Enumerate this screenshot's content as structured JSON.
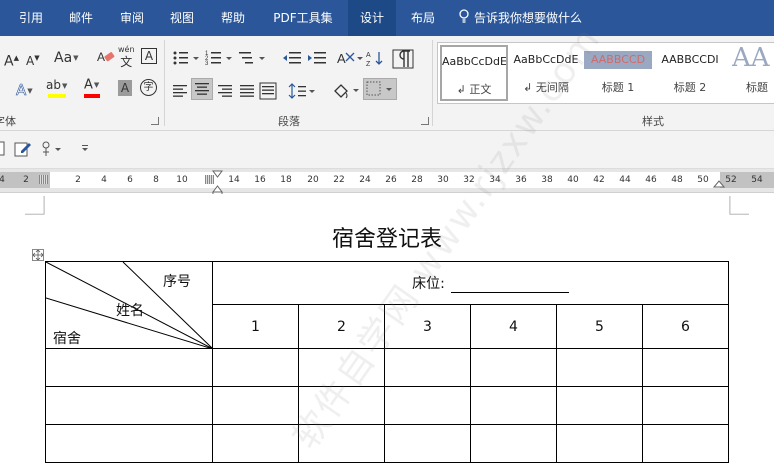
{
  "menu": {
    "tabs": [
      "引用",
      "邮件",
      "审阅",
      "视图",
      "帮助",
      "PDF工具集",
      "设计",
      "布局"
    ],
    "active_tab": "设计",
    "tell_me": "告诉我你想要做什么"
  },
  "ribbon": {
    "groups": {
      "font": "字体",
      "paragraph": "段落",
      "styles": "样式"
    },
    "font_controls": {
      "grow": "A",
      "shrink": "A",
      "change_case": "Aa",
      "pinyin": "wén",
      "char_border": "A",
      "text_effects": "A",
      "highlight": "ab",
      "font_color": "A",
      "char_shading": "A",
      "enclose": "字"
    },
    "styles": [
      {
        "sample": "AaBbCcDdE",
        "name": "正文",
        "marker": "↲"
      },
      {
        "sample": "AaBbCcDdE",
        "name": "无间隔",
        "marker": "↲"
      },
      {
        "sample": "AABBCCD",
        "name": "标题 1",
        "marker": ""
      },
      {
        "sample": "AABBCCDI",
        "name": "标题 2",
        "marker": ""
      },
      {
        "sample": "AA",
        "name": "标题",
        "marker": ""
      }
    ]
  },
  "ruler": {
    "left_ticks": [
      "4",
      "2"
    ],
    "ticks": [
      "2",
      "4",
      "6",
      "8",
      "10",
      "14",
      "16",
      "18",
      "20",
      "22",
      "24",
      "26",
      "28",
      "30",
      "32",
      "34",
      "36",
      "38",
      "40",
      "42",
      "44",
      "46",
      "48",
      "50",
      "52",
      "54"
    ]
  },
  "document": {
    "title": "宿舍登记表",
    "header": {
      "diag_top": "序号",
      "diag_mid": "姓名",
      "diag_bottom": "宿舍",
      "bed_label": "床位:"
    },
    "columns": [
      "1",
      "2",
      "3",
      "4",
      "5",
      "6"
    ],
    "watermark": "软件自学网 www.rjzxw.com"
  }
}
